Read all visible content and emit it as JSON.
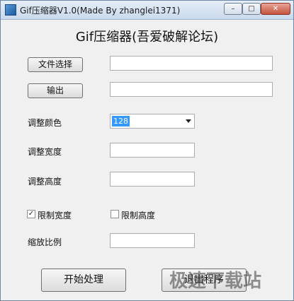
{
  "window": {
    "title": "Gif压缩器V1.0(Made By zhanglei1371)",
    "controls": {
      "minimize": "–",
      "maximize": "□",
      "close": "✕"
    }
  },
  "heading": "Gif压缩器(吾爱破解论坛)",
  "file_select": {
    "label": "文件选择",
    "value": ""
  },
  "output": {
    "label": "输出",
    "value": ""
  },
  "colors": {
    "label": "调整颜色",
    "value": "128"
  },
  "width": {
    "label": "调整宽度",
    "value": ""
  },
  "height": {
    "label": "调整高度",
    "value": ""
  },
  "limit_width": {
    "label": "限制宽度",
    "checked": true
  },
  "limit_height": {
    "label": "限制高度",
    "checked": false
  },
  "scale": {
    "label": "缩放比例",
    "value": ""
  },
  "start_button": "开始处理",
  "exit_button": "退出程序",
  "watermark": "极速下载站"
}
